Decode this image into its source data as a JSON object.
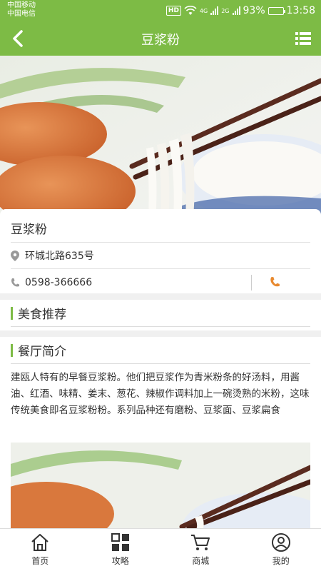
{
  "status_bar": {
    "carrier_1": "中国移动",
    "carrier_2": "中国电信",
    "hd": "HD",
    "net_1": "4G",
    "net_2": "2G",
    "battery": "93%",
    "time": "13:58"
  },
  "header": {
    "title": "豆浆粉"
  },
  "restaurant": {
    "name": "豆浆粉",
    "address": "环城北路635号",
    "phone": "0598-366666"
  },
  "sections": {
    "recommend_title": "美食推荐",
    "intro_title": "餐厅简介",
    "intro_text": "建瓯人特有的早餐豆浆粉。他们把豆浆作为青米粉条的好汤料，用酱油、红酒、味精、姜末、葱花、辣椒作调料加上一碗烫熟的米粉，这味传统美食即名豆浆粉粉。系列品种还有磨粉、豆浆面、豆浆扁食"
  },
  "bottom_nav": [
    {
      "label": "首页",
      "icon": "home-icon"
    },
    {
      "label": "攻略",
      "icon": "grid-icon"
    },
    {
      "label": "商城",
      "icon": "cart-icon"
    },
    {
      "label": "我的",
      "icon": "user-icon"
    }
  ],
  "colors": {
    "brand": "#7dbb45",
    "call": "#e8892f"
  }
}
